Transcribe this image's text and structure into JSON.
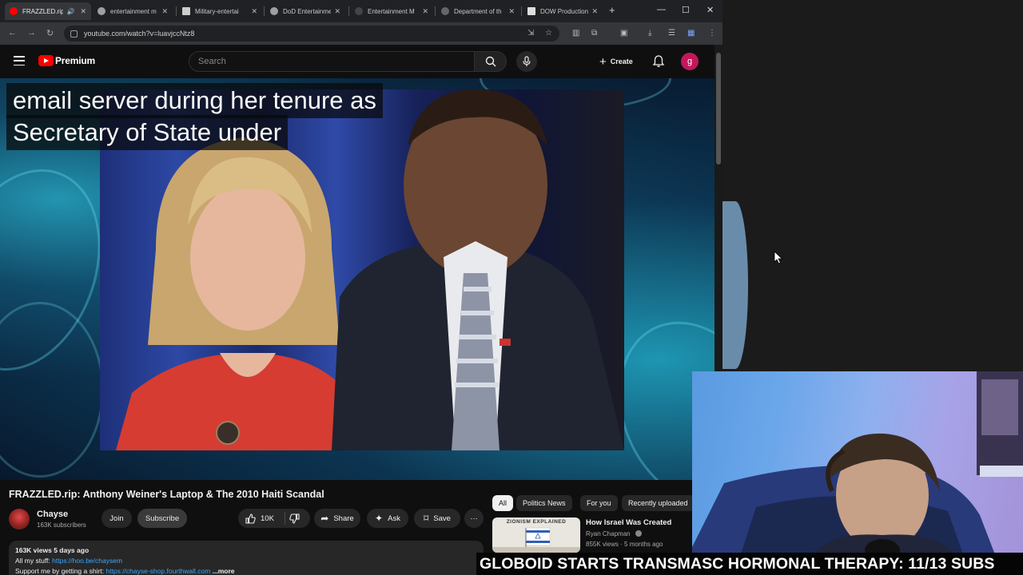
{
  "browser": {
    "tabs": [
      {
        "title": "FRAZZLED.rip",
        "favicon_color": "#ff0000",
        "active": true
      },
      {
        "title": "entertainment m",
        "favicon_color": "#9aa0a6",
        "active": false
      },
      {
        "title": "Military-entertai",
        "favicon_color": "#cccccc",
        "active": false
      },
      {
        "title": "DoD Entertainme",
        "favicon_color": "#9aa0a6",
        "active": false
      },
      {
        "title": "Entertainment M",
        "favicon_color": "#444444",
        "active": false
      },
      {
        "title": "Department of th",
        "favicon_color": "#666666",
        "active": false
      },
      {
        "title": "DOW Production",
        "favicon_color": "#dddddd",
        "active": false
      }
    ],
    "new_tab_symbol": "+",
    "window_controls": {
      "minimize": "—",
      "maximize": "☐",
      "close": "✕"
    },
    "url": "youtube.com/watch?v=luavjccNtz8"
  },
  "youtube": {
    "logo_text": "Premium",
    "search_placeholder": "Search",
    "create_label": "Create",
    "avatar_letter": "g",
    "video": {
      "caption_line1": "email server during her tenure as",
      "caption_line2": "Secretary of State under"
    },
    "title": "FRAZZLED.rip: Anthony Weiner's Laptop & The 2010 Haiti Scandal",
    "channel": {
      "name": "Chayse",
      "subscribers": "163K subscribers",
      "join_label": "Join",
      "subscribe_label": "Subscribe"
    },
    "actions": {
      "likes": "10K",
      "share_label": "Share",
      "ask_label": "Ask",
      "save_label": "Save",
      "more_symbol": "···"
    },
    "description": {
      "views_date": "163K views  5 days ago",
      "line2_prefix": "All my stuff: ",
      "line2_link": "https://hoo.be/chaysem",
      "line3_prefix": "Support me by getting a shirt: ",
      "line3_link": "https://chayse-shop.fourthwall.com",
      "more_label": " ...more"
    },
    "chips": [
      "All",
      "Politics News",
      "For you",
      "Recently uploaded"
    ],
    "recommendation": {
      "thumb_text": "ZIONISM EXPLAINED",
      "title": "How Israel Was Created",
      "channel": "Ryan Chapman",
      "meta": "855K views · 5 months ago"
    }
  },
  "overlay": {
    "banner_text": "GLOBOID STARTS TRANSMASC HORMONAL THERAPY: 11/13 SUBS"
  },
  "colors": {
    "youtube_red": "#ff0000",
    "link_blue": "#3ea6ff",
    "avatar_pink": "#c2185b"
  }
}
